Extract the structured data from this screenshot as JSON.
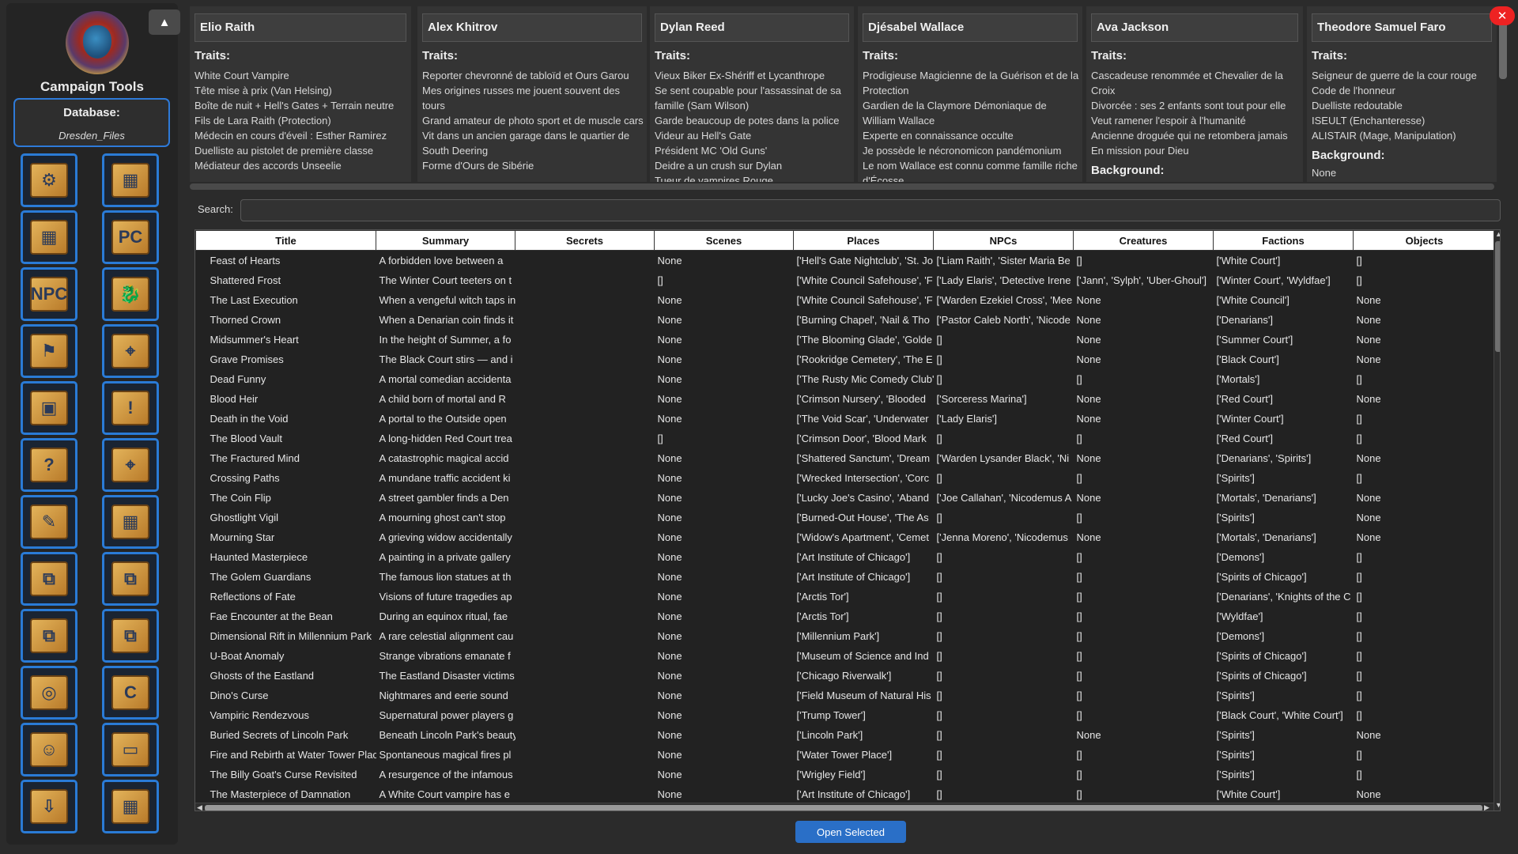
{
  "sidebar": {
    "collapse_icon": "▲",
    "title": "Campaign Tools",
    "database_label": "Database:",
    "database_name": "Dresden_Files",
    "tools": [
      {
        "name": "database-gear-icon",
        "glyph": "⚙"
      },
      {
        "name": "scene-map-icon",
        "glyph": "▦"
      },
      {
        "name": "places-map-icon",
        "glyph": "▦"
      },
      {
        "name": "pc-character-icon",
        "glyph": "PC"
      },
      {
        "name": "npc-character-icon",
        "glyph": "NPC"
      },
      {
        "name": "creature-dragon-icon",
        "glyph": "🐉"
      },
      {
        "name": "faction-flag-icon",
        "glyph": "⚑"
      },
      {
        "name": "map-pin-icon",
        "glyph": "⌖"
      },
      {
        "name": "objects-boxes-icon",
        "glyph": "▣"
      },
      {
        "name": "alert-exclamation-icon",
        "glyph": "!"
      },
      {
        "name": "question-icon",
        "glyph": "?"
      },
      {
        "name": "location-pin-map-icon",
        "glyph": "⌖"
      },
      {
        "name": "document-export-icon",
        "glyph": "✎"
      },
      {
        "name": "map-tools-icon",
        "glyph": "▦"
      },
      {
        "name": "graph-icon-1",
        "glyph": "⧉"
      },
      {
        "name": "graph-icon-2",
        "glyph": "⧉"
      },
      {
        "name": "graph-icon-3",
        "glyph": "⧉"
      },
      {
        "name": "graph-icon-4",
        "glyph": "⧉"
      },
      {
        "name": "foundry-icon",
        "glyph": "◎"
      },
      {
        "name": "refresh-c-icon",
        "glyph": "C"
      },
      {
        "name": "user-profile-icon",
        "glyph": "☺"
      },
      {
        "name": "screen-display-icon",
        "glyph": "▭"
      },
      {
        "name": "import-icon",
        "glyph": "⇩"
      },
      {
        "name": "map-display-icon",
        "glyph": "▦"
      }
    ]
  },
  "cards": [
    {
      "name": "Elio Raith",
      "traits_label": "Traits:",
      "traits": [
        "White Court Vampire",
        "Tête mise à prix (Van Helsing)",
        "Boîte de nuit + Hell's Gates + Terrain neutre",
        "Fils de Lara Raith (Protection)",
        "Médecin en cours d'éveil : Esther Ramirez",
        "Duelliste au pistolet de première classe",
        "Médiateur des accords Unseelie"
      ],
      "background_label": ""
    },
    {
      "name": "Alex Khitrov",
      "traits_label": "Traits:",
      "traits": [
        "Reporter chevronné de tabloïd et Ours Garou",
        "Mes origines russes me jouent souvent des tours",
        "Grand amateur de photo sport et de muscle cars",
        "Vit dans un ancien garage dans le quartier de South Deering",
        "Forme d'Ours de Sibérie"
      ],
      "background_label": ""
    },
    {
      "name": "Dylan Reed",
      "traits_label": "Traits:",
      "traits": [
        "Vieux Biker Ex-Shériff et Lycanthrope",
        "Se sent coupable pour l'assassinat de sa famille (Sam Wilson)",
        "Garde beaucoup de potes dans la police",
        "Videur au Hell's Gate",
        "Président MC 'Old Guns'",
        "Deidre a un crush sur Dylan",
        "Tueur de vampires Rouge"
      ],
      "background_label": ""
    },
    {
      "name": "Djésabel Wallace",
      "traits_label": "Traits:",
      "traits": [
        "Prodigieuse Magicienne de la Guérison et de la Protection",
        "Gardien de la Claymore Démoniaque de William Wallace",
        "Experte en connaissance occulte",
        "Je possède le nécronomicon pandémonium",
        "Le nom Wallace est connu comme famille riche d'Écosse"
      ],
      "background_label": ""
    },
    {
      "name": "Ava Jackson",
      "traits_label": "Traits:",
      "traits": [
        "Cascadeuse renommée et Chevalier de la Croix",
        "Divorcée : ses 2 enfants sont tout pour elle",
        "Veut ramener l'espoir à l'humanité",
        "Ancienne droguée qui ne retombera jamais",
        "En mission pour Dieu"
      ],
      "background_label": "Background:"
    },
    {
      "name": "Theodore  Samuel Faro",
      "traits_label": "Traits:",
      "traits": [
        "Seigneur de guerre de la cour rouge",
        "Code de l'honneur",
        "Duelliste redoutable",
        "ISEULT (Enchanteresse)",
        "ALISTAIR (Mage, Manipulation)"
      ],
      "background_label": "Background:",
      "background": "None"
    }
  ],
  "search": {
    "label": "Search:",
    "value": ""
  },
  "table": {
    "columns": [
      "Title",
      "Summary",
      "Secrets",
      "Scenes",
      "Places",
      "NPCs",
      "Creatures",
      "Factions",
      "Objects"
    ],
    "rows": [
      [
        "Feast of Hearts",
        "A forbidden love between a ",
        "",
        "None",
        "['Hell's Gate Nightclub', 'St. Jo",
        "['Liam Raith', 'Sister Maria Be",
        "[]",
        "['White Court']",
        "[]"
      ],
      [
        "Shattered Frost",
        "The Winter Court teeters on t",
        "",
        "[]",
        "['White Council Safehouse', 'F",
        "['Lady Elaris', 'Detective Irene",
        "['Jann', 'Sylph', 'Uber-Ghoul']",
        "['Winter Court', 'Wyldfae']",
        "[]"
      ],
      [
        "The Last Execution",
        "When a vengeful witch taps in",
        "",
        "None",
        "['White Council Safehouse', 'F",
        "['Warden Ezekiel Cross', 'Mee",
        "None",
        "['White Council']",
        "None"
      ],
      [
        "Thorned Crown",
        "When a Denarian coin finds it",
        "",
        "None",
        "['Burning Chapel', 'Nail & Tho",
        "['Pastor Caleb North', 'Nicode",
        "None",
        "['Denarians']",
        "None"
      ],
      [
        "Midsummer's Heart",
        "In the height of Summer, a fo",
        "",
        "None",
        "['The Blooming Glade', 'Golde",
        "[]",
        "None",
        "['Summer Court']",
        "None"
      ],
      [
        "Grave Promises",
        "The Black Court stirs — and i",
        "",
        "None",
        "['Rookridge Cemetery', 'The E",
        "[]",
        "None",
        "['Black Court']",
        "None"
      ],
      [
        "Dead Funny",
        "A mortal comedian accidenta",
        "",
        "None",
        "['The Rusty Mic Comedy Club'",
        "[]",
        "[]",
        "['Mortals']",
        "[]"
      ],
      [
        "Blood Heir",
        "A child born of mortal and R",
        "",
        "None",
        "['Crimson Nursery', 'Blooded",
        "['Sorceress Marina']",
        "None",
        "['Red Court']",
        "None"
      ],
      [
        "Death in the Void",
        "A portal to the Outside open",
        "",
        "None",
        "['The Void Scar', 'Underwater",
        "['Lady Elaris']",
        "None",
        "['Winter Court']",
        "[]"
      ],
      [
        "The Blood Vault",
        "A long-hidden Red Court trea",
        "",
        "[]",
        "['Crimson Door', 'Blood Mark",
        "[]",
        "[]",
        "['Red Court']",
        "[]"
      ],
      [
        "The Fractured Mind",
        "A catastrophic magical accid",
        "",
        "None",
        "['Shattered Sanctum', 'Dream",
        "['Warden Lysander Black', 'Ni",
        "None",
        "['Denarians', 'Spirits']",
        "None"
      ],
      [
        "Crossing Paths",
        "A mundane traffic accident ki",
        "",
        "None",
        "['Wrecked Intersection', 'Corc",
        "[]",
        "[]",
        "['Spirits']",
        "[]"
      ],
      [
        "The Coin Flip",
        "A street gambler finds a Den",
        "",
        "None",
        "['Lucky Joe's Casino', 'Aband",
        "['Joe Callahan', 'Nicodemus A",
        "None",
        "['Mortals', 'Denarians']",
        "None"
      ],
      [
        "Ghostlight Vigil",
        "A mourning ghost can't stop",
        "",
        "None",
        "['Burned-Out House', 'The As",
        "[]",
        "[]",
        "['Spirits']",
        "None"
      ],
      [
        "Mourning Star",
        "A grieving widow accidentally",
        "",
        "None",
        "['Widow's Apartment', 'Cemet",
        "['Jenna Moreno', 'Nicodemus",
        "None",
        "['Mortals', 'Denarians']",
        "None"
      ],
      [
        "Haunted Masterpiece",
        "A painting in a private gallery",
        "",
        "None",
        "['Art Institute of Chicago']",
        "[]",
        "[]",
        "['Demons']",
        "[]"
      ],
      [
        "The Golem Guardians",
        "The famous lion statues at th",
        "",
        "None",
        "['Art Institute of Chicago']",
        "[]",
        "[]",
        "['Spirits of Chicago']",
        "[]"
      ],
      [
        "Reflections of Fate",
        "Visions of future tragedies ap",
        "",
        "None",
        "['Arctis Tor']",
        "[]",
        "[]",
        "['Denarians', 'Knights of the C",
        "[]"
      ],
      [
        "Fae Encounter at the Bean",
        "During an equinox ritual, fae",
        "",
        "None",
        "['Arctis Tor']",
        "[]",
        "[]",
        "['Wyldfae']",
        "[]"
      ],
      [
        "Dimensional Rift in Millennium Park",
        "A rare celestial alignment cau",
        "",
        "None",
        "['Millennium Park']",
        "[]",
        "[]",
        "['Demons']",
        "[]"
      ],
      [
        "U-Boat Anomaly",
        "Strange vibrations emanate f",
        "",
        "None",
        "['Museum of Science and Ind",
        "[]",
        "[]",
        "['Spirits of Chicago']",
        "[]"
      ],
      [
        "Ghosts of the Eastland",
        "The Eastland Disaster victims",
        "",
        "None",
        "['Chicago Riverwalk']",
        "[]",
        "[]",
        "['Spirits of Chicago']",
        "[]"
      ],
      [
        "Dino's Curse",
        "Nightmares and eerie sound",
        "",
        "None",
        "['Field Museum of Natural His",
        "[]",
        "[]",
        "['Spirits']",
        "[]"
      ],
      [
        "Vampiric Rendezvous",
        "Supernatural power players g",
        "",
        "None",
        "['Trump Tower']",
        "[]",
        "[]",
        "['Black Court', 'White Court']",
        "[]"
      ],
      [
        "Buried Secrets of Lincoln Park",
        "Beneath Lincoln Park's beauty",
        "",
        "None",
        "['Lincoln Park']",
        "[]",
        "None",
        "['Spirits']",
        "None"
      ],
      [
        "Fire and Rebirth at Water Tower Plac",
        "Spontaneous magical fires pl",
        "",
        "None",
        "['Water Tower Place']",
        "[]",
        "[]",
        "['Spirits']",
        "[]"
      ],
      [
        "The Billy Goat's Curse Revisited",
        "A resurgence of the infamous",
        "",
        "None",
        "['Wrigley Field']",
        "[]",
        "[]",
        "['Spirits']",
        "[]"
      ],
      [
        "The Masterpiece of Damnation",
        "A White Court vampire has e",
        "",
        "None",
        "['Art Institute of Chicago']",
        "[]",
        "[]",
        "['White Court']",
        "None"
      ]
    ]
  },
  "open_button": "Open Selected",
  "close_icon": "✕"
}
